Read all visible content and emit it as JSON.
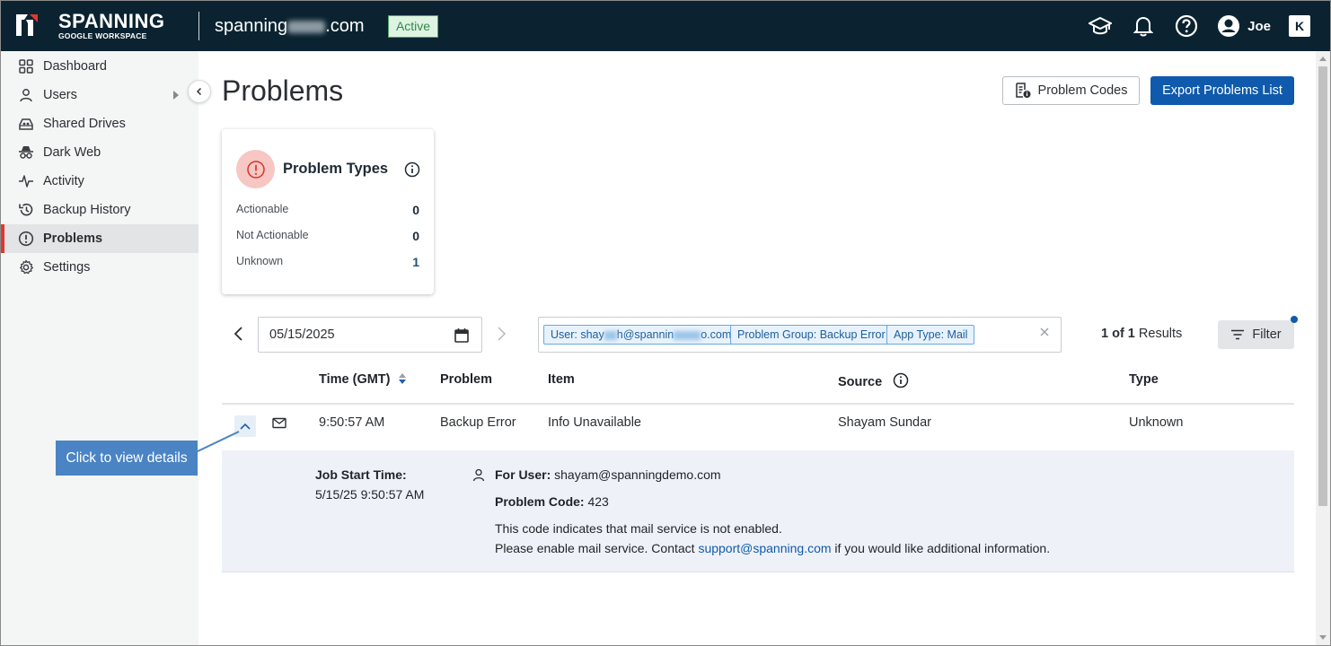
{
  "header": {
    "brand": "SPANNING",
    "brand_sub": "GOOGLE WORKSPACE",
    "domain_prefix": "spanning",
    "domain_suffix": ".com",
    "status": "Active",
    "user_name": "Joe",
    "k_badge": "K"
  },
  "sidebar": {
    "items": [
      {
        "label": "Dashboard",
        "icon": "grid-icon"
      },
      {
        "label": "Users",
        "icon": "user-icon"
      },
      {
        "label": "Shared Drives",
        "icon": "shared-drive-icon"
      },
      {
        "label": "Dark Web",
        "icon": "spy-icon"
      },
      {
        "label": "Activity",
        "icon": "activity-icon"
      },
      {
        "label": "Backup History",
        "icon": "history-icon"
      },
      {
        "label": "Problems",
        "icon": "alert-circle-icon",
        "active": true
      },
      {
        "label": "Settings",
        "icon": "gear-icon"
      }
    ]
  },
  "page": {
    "title": "Problems",
    "problem_codes_label": "Problem Codes",
    "export_label": "Export Problems List"
  },
  "problem_types": {
    "title": "Problem Types",
    "rows": [
      {
        "label": "Actionable",
        "value": "0"
      },
      {
        "label": "Not Actionable",
        "value": "0"
      },
      {
        "label": "Unknown",
        "value": "1"
      }
    ]
  },
  "filters": {
    "date": "05/15/2025",
    "chips": {
      "user_prefix": "User: shay",
      "user_mid": "h@spannin",
      "user_suffix": "o.com",
      "problem_group": "Problem Group: Backup Error",
      "app_type": "App Type: Mail"
    },
    "results_count": "1 of 1",
    "results_label": "Results",
    "filter_label": "Filter"
  },
  "table": {
    "headers": {
      "time": "Time (GMT)",
      "problem": "Problem",
      "item": "Item",
      "source": "Source",
      "type": "Type"
    },
    "row": {
      "time": "9:50:57 AM",
      "problem": "Backup Error",
      "item": "Info Unavailable",
      "source": "Shayam Sundar",
      "type": "Unknown"
    }
  },
  "detail": {
    "job_start_label": "Job Start Time:",
    "job_start_value": "5/15/25 9:50:57 AM",
    "for_user_label": "For User:",
    "for_user_value": "shayam@spanningdemo.com",
    "problem_code_label": "Problem Code:",
    "problem_code_value": "423",
    "desc_line1": "This code indicates that mail service is not enabled.",
    "desc_line2_pre": "Please enable mail service. Contact ",
    "desc_link": "support@spanning.com",
    "desc_line2_post": " if you would like additional information."
  },
  "callout": {
    "text": "Click to view details"
  },
  "colors": {
    "topbar": "#0b2330",
    "primary": "#0f5aad",
    "active_accent": "#e0382c",
    "status_green": "#2f8a47"
  }
}
